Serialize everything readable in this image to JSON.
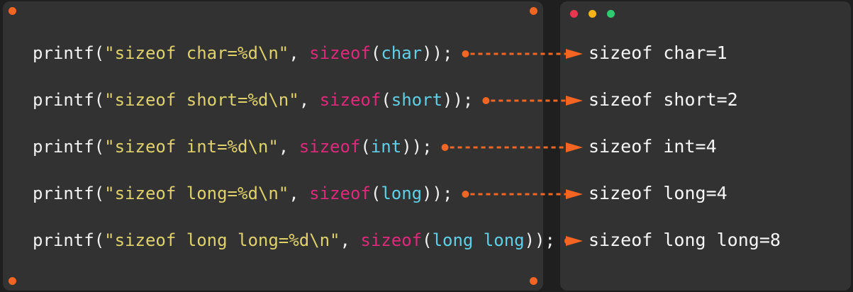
{
  "colors": {
    "background": "#1f1f1f",
    "panel": "#323232",
    "accent": "#f26522",
    "string": "#e0d26a",
    "keyword": "#e0297a",
    "type": "#5fd0e8",
    "text": "#f2f2f2",
    "window_red": "#e8384f",
    "window_yellow": "#f5b51a",
    "window_green": "#2ecc71"
  },
  "code_lines": [
    {
      "fn": "printf(",
      "str": "\"sizeof char=%d\\n\"",
      "comma": ", ",
      "kw": "sizeof",
      "open": "(",
      "type": "char",
      "close": "));"
    },
    {
      "fn": "printf(",
      "str": "\"sizeof short=%d\\n\"",
      "comma": ", ",
      "kw": "sizeof",
      "open": "(",
      "type": "short",
      "close": "));"
    },
    {
      "fn": "printf(",
      "str": "\"sizeof int=%d\\n\"",
      "comma": ", ",
      "kw": "sizeof",
      "open": "(",
      "type": "int",
      "close": "));"
    },
    {
      "fn": "printf(",
      "str": "\"sizeof long=%d\\n\"",
      "comma": ", ",
      "kw": "sizeof",
      "open": "(",
      "type": "long",
      "close": "));"
    },
    {
      "fn": "printf(",
      "str": "\"sizeof long long=%d\\n\"",
      "comma": ", ",
      "kw": "sizeof",
      "open": "(",
      "type": "long long",
      "close": "));"
    }
  ],
  "output_lines": [
    "sizeof char=1",
    "sizeof short=2",
    "sizeof int=4",
    "sizeof long=4",
    "sizeof long long=8"
  ]
}
